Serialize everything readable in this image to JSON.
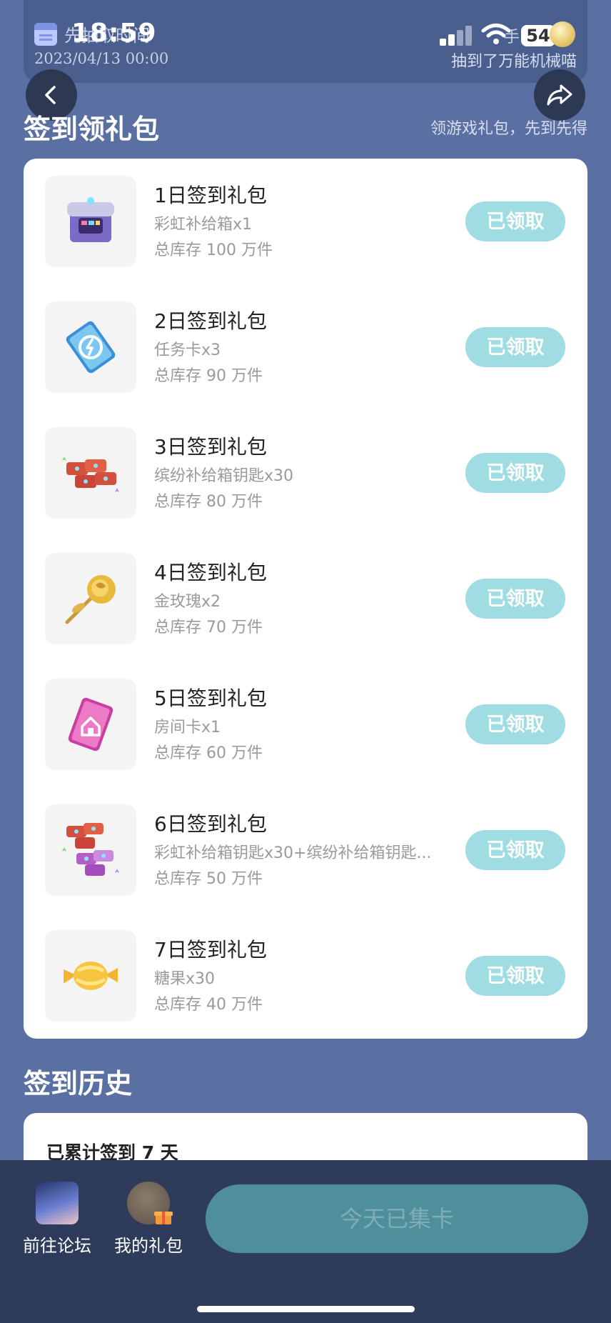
{
  "status_bar": {
    "time": "18:59",
    "battery": "54"
  },
  "top_banner": {
    "draw_time_label": "先抽取时间",
    "draw_date": "2023/04/13 00:00",
    "hand_label": "手",
    "draw_result": "抽到了万能机械喵"
  },
  "checkin": {
    "title": "签到领礼包",
    "subtitle": "领游戏礼包，先到先得",
    "items": [
      {
        "title": "1日签到礼包",
        "desc": "彩虹补给箱x1",
        "stock": "总库存 100 万件",
        "button": "已领取",
        "icon": "rainbow-supply-box-icon"
      },
      {
        "title": "2日签到礼包",
        "desc": "任务卡x3",
        "stock": "总库存 90 万件",
        "button": "已领取",
        "icon": "task-card-icon"
      },
      {
        "title": "3日签到礼包",
        "desc": "缤纷补给箱钥匙x30",
        "stock": "总库存 80 万件",
        "button": "已领取",
        "icon": "colorful-supply-key-icon"
      },
      {
        "title": "4日签到礼包",
        "desc": "金玫瑰x2",
        "stock": "总库存 70 万件",
        "button": "已领取",
        "icon": "golden-rose-icon"
      },
      {
        "title": "5日签到礼包",
        "desc": "房间卡x1",
        "stock": "总库存 60 万件",
        "button": "已领取",
        "icon": "room-card-icon"
      },
      {
        "title": "6日签到礼包",
        "desc": "彩虹补给箱钥匙x30+缤纷补给箱钥匙...",
        "stock": "总库存 50 万件",
        "button": "已领取",
        "icon": "supply-keys-bundle-icon"
      },
      {
        "title": "7日签到礼包",
        "desc": "糖果x30",
        "stock": "总库存 40 万件",
        "button": "已领取",
        "icon": "candy-icon"
      }
    ]
  },
  "history": {
    "title": "签到历史",
    "count_text": "已累计签到 7 天"
  },
  "bottom_bar": {
    "forum_label": "前往论坛",
    "gifts_label": "我的礼包",
    "collect_button": "今天已集卡"
  },
  "colors": {
    "background": "#5b70a2",
    "claim_button": "#9fdde2",
    "bottom_bar": "#2f3b5a",
    "collect_button": "#4e8f9b"
  }
}
